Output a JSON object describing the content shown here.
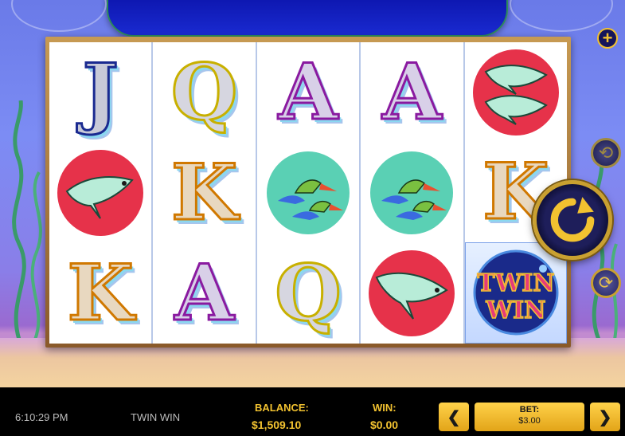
{
  "game": {
    "title": "TWIN WIN",
    "logo_line1": "TWIN",
    "logo_line2": "WIN"
  },
  "reels": [
    [
      "J",
      "manta-ray",
      "K"
    ],
    [
      "Q",
      "K",
      "A"
    ],
    [
      "A",
      "pelicans",
      "Q"
    ],
    [
      "A",
      "pelicans",
      "manta-ray"
    ],
    [
      "manta-ray",
      "K",
      "twin-win-logo"
    ]
  ],
  "controls": {
    "plus_icon": "plus-icon",
    "auto_icon": "autoplay-icon",
    "spin_icon": "spin-arrow-icon",
    "refresh_icon": "refresh-icon"
  },
  "status_bar": {
    "clock": "6:10:29 PM",
    "game_name": "TWIN WIN",
    "balance_label": "BALANCE:",
    "balance_value": "$1,509.10",
    "win_label": "WIN:",
    "win_value": "$0.00",
    "bet_label": "BET:",
    "bet_value": "$3.00",
    "bet_decrease": "❮",
    "bet_increase": "❯"
  },
  "colors": {
    "accent_gold": "#f2c230",
    "bar_bg": "#000000",
    "banner_blue": "#0a12a8"
  }
}
